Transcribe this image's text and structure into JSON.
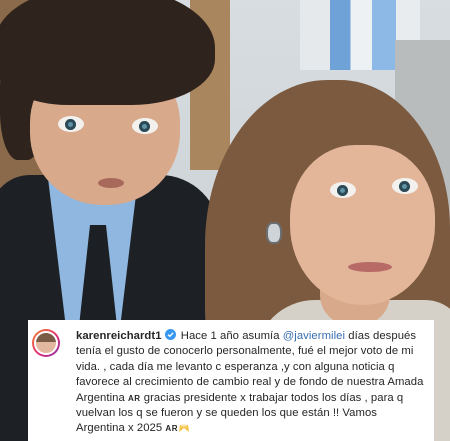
{
  "post": {
    "username": "karenreichardt1",
    "verified_icon": "verified-badge-icon",
    "mention": "@javiermilei",
    "caption_part1": "Hace 1 año asumía",
    "caption_part2": "días después tenía el gusto de conocerlo personalmente, fué el mejor voto de mi vida. , cada día me levanto c esperanza ,y con alguna noticia q favorece al crecimiento de cambio real y de fondo de nuestra Amada Argentina",
    "flag_code_1": "AR",
    "caption_part3": "gracias presidente x trabajar todos los días , para q vuelvan los q se fueron y se queden los que están !! Vamos Argentina x 2025",
    "flag_code_2": "AR",
    "emoji_icon": "raising-hands-icon"
  },
  "colors": {
    "mention": "#3a6fb0",
    "verified": "#3897f0",
    "text": "#262626"
  }
}
